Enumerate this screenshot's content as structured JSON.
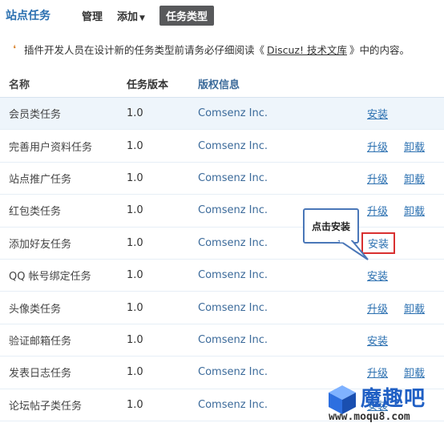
{
  "header": {
    "site_title": "站点任务",
    "nav": {
      "manage": "管理",
      "add": "添加",
      "task_types": "任务类型"
    }
  },
  "tip": {
    "prefix": "插件开发人员在设计新的任务类型前请务必仔细阅读《",
    "link": "Discuz! 技术文库",
    "suffix": "》中的内容。"
  },
  "table": {
    "columns": {
      "name": "名称",
      "version": "任务版本",
      "copyright": "版权信息"
    },
    "rows": [
      {
        "name": "会员类任务",
        "version": "1.0",
        "copyright": "Comsenz Inc.",
        "op1": "安装",
        "op2": ""
      },
      {
        "name": "完善用户资料任务",
        "version": "1.0",
        "copyright": "Comsenz Inc.",
        "op1": "升级",
        "op2": "卸载"
      },
      {
        "name": "站点推广任务",
        "version": "1.0",
        "copyright": "Comsenz Inc.",
        "op1": "升级",
        "op2": "卸载"
      },
      {
        "name": "红包类任务",
        "version": "1.0",
        "copyright": "Comsenz Inc.",
        "op1": "升级",
        "op2": "卸载"
      },
      {
        "name": "添加好友任务",
        "version": "1.0",
        "copyright": "Comsenz Inc.",
        "op1": "安装",
        "op2": ""
      },
      {
        "name": "QQ 帐号绑定任务",
        "version": "1.0",
        "copyright": "Comsenz Inc.",
        "op1": "安装",
        "op2": ""
      },
      {
        "name": "头像类任务",
        "version": "1.0",
        "copyright": "Comsenz Inc.",
        "op1": "升级",
        "op2": "卸载"
      },
      {
        "name": "验证邮箱任务",
        "version": "1.0",
        "copyright": "Comsenz Inc.",
        "op1": "安装",
        "op2": ""
      },
      {
        "name": "发表日志任务",
        "version": "1.0",
        "copyright": "Comsenz Inc.",
        "op1": "升级",
        "op2": "卸载"
      },
      {
        "name": "论坛帖子类任务",
        "version": "1.0",
        "copyright": "Comsenz Inc.",
        "op1": "安装",
        "op2": ""
      }
    ]
  },
  "callout": {
    "text": "点击安装"
  },
  "watermark": {
    "name": "魔趣吧",
    "url": "www.moqu8.com"
  },
  "colors": {
    "accent": "#2a6fb0",
    "highlight_box": "#d93030",
    "callout_border": "#4a77b8"
  }
}
